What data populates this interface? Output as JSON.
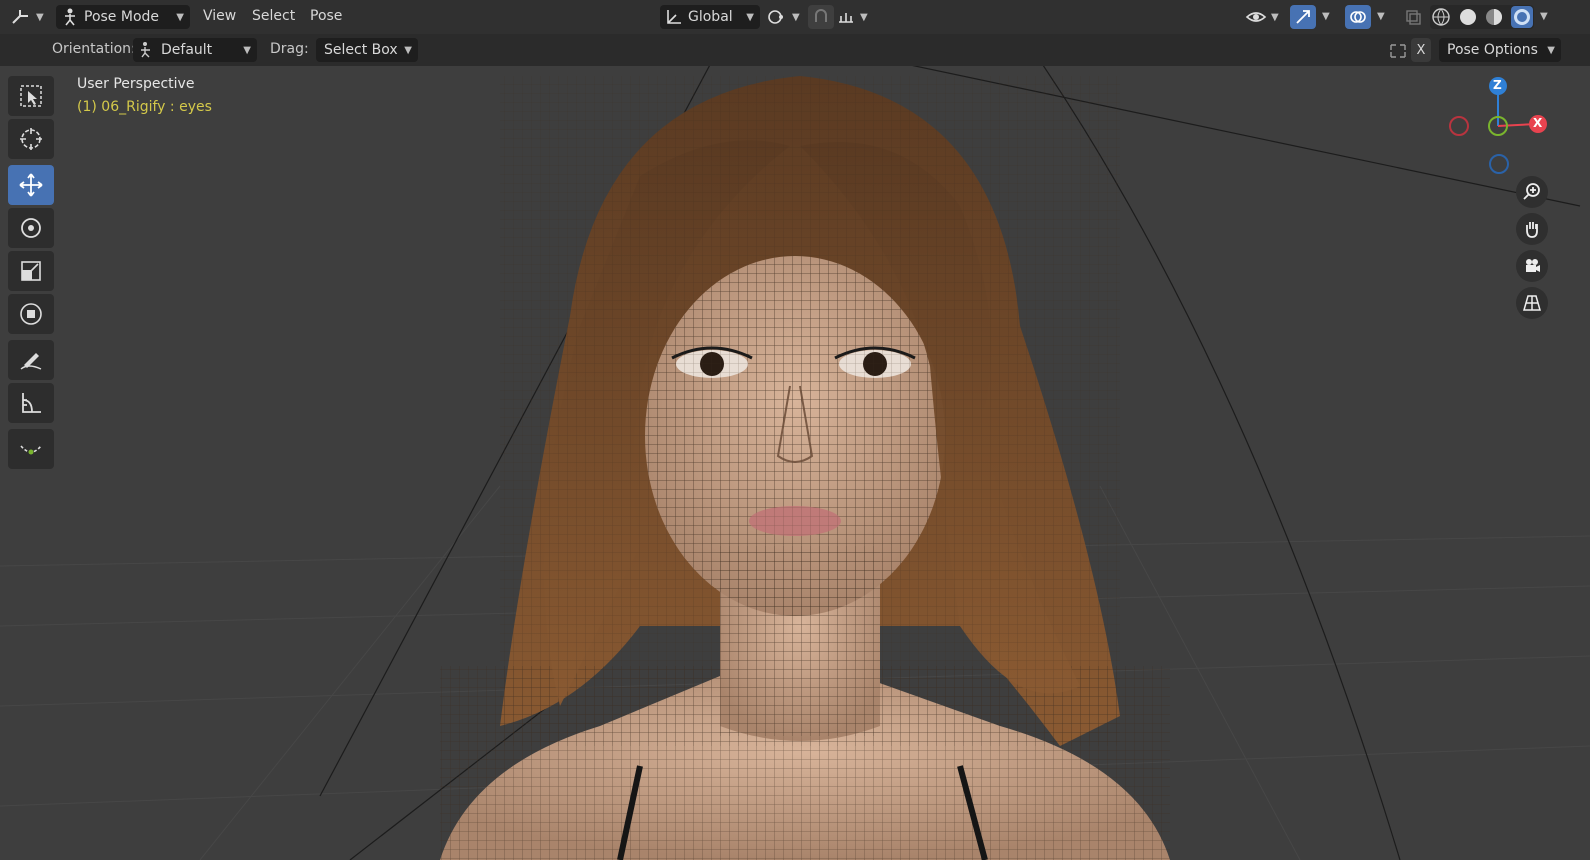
{
  "header": {
    "mode_label": "Pose Mode",
    "menus": [
      "View",
      "Select",
      "Pose"
    ],
    "transform_orientation": "Global",
    "icons": [
      "editor-type-icon",
      "pose-mode-icon",
      "transform-orientation-icon",
      "pivot-icon",
      "snap-icon",
      "proportional-icon",
      "visibility-icon",
      "gizmo-icon",
      "overlay-icon",
      "xray-icon",
      "wireframe-shading-icon",
      "solid-shading-icon",
      "material-shading-icon",
      "rendered-shading-icon"
    ]
  },
  "tool_header": {
    "orientation_label": "Orientation:",
    "orientation_value": "Default",
    "drag_label": "Drag:",
    "drag_value": "Select Box",
    "x_label": "X",
    "pose_options": "Pose Options"
  },
  "viewport": {
    "view_name": "User Perspective",
    "object_info": "(1) 06_Rigify : eyes"
  },
  "gizmo": {
    "z": "Z",
    "x": "X"
  },
  "toolbar": [
    "select-box",
    "cursor",
    "move",
    "rotate",
    "scale",
    "transform",
    "annotate",
    "measure",
    "bone-roll"
  ],
  "colors": {
    "accent": "#4772b3",
    "info_text": "#d4c94a",
    "x_axis": "#e8434f",
    "y_axis": "#7ab52e",
    "z_axis": "#2f80d6"
  }
}
